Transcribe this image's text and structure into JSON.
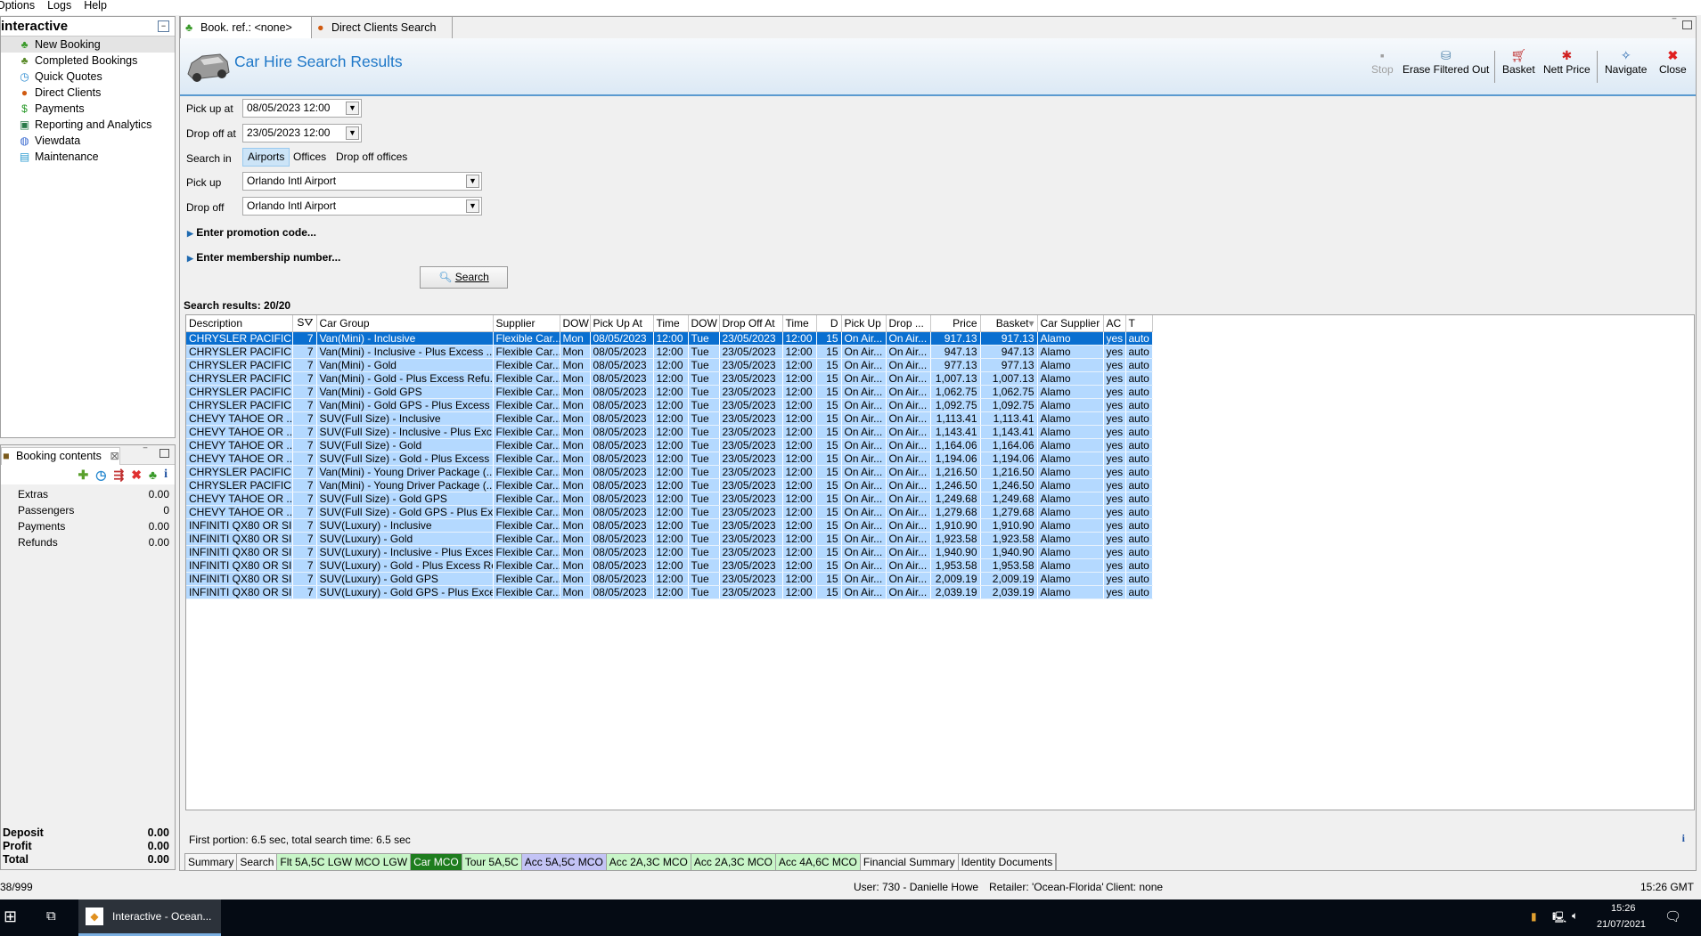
{
  "menu": [
    "Options",
    "Logs",
    "Help"
  ],
  "left": {
    "title": "interactive",
    "items": [
      {
        "label": "New Booking",
        "icon": "palm-tree-icon"
      },
      {
        "label": "Completed Bookings",
        "icon": "palm-money-icon"
      },
      {
        "label": "Quick Quotes",
        "icon": "clock-icon"
      },
      {
        "label": "Direct Clients",
        "icon": "person-icon"
      },
      {
        "label": "Payments",
        "icon": "dollar-icon"
      },
      {
        "label": "Reporting and Analytics",
        "icon": "report-icon"
      },
      {
        "label": "Viewdata",
        "icon": "globe-icon"
      },
      {
        "label": "Maintenance",
        "icon": "books-icon"
      }
    ]
  },
  "booking": {
    "title": "Booking contents",
    "rows": [
      {
        "label": "Extras",
        "value": "0.00"
      },
      {
        "label": "Passengers",
        "value": "0"
      },
      {
        "label": "Payments",
        "value": "0.00"
      },
      {
        "label": "Refunds",
        "value": "0.00"
      }
    ],
    "totals": [
      {
        "label": "Deposit",
        "value": "0.00"
      },
      {
        "label": "Profit",
        "value": "0.00"
      },
      {
        "label": "Total",
        "value": "0.00"
      }
    ]
  },
  "tabs": [
    {
      "label": "Book. ref.: <none>"
    },
    {
      "label": "Direct Clients Search"
    }
  ],
  "header": {
    "title": "Car Hire Search Results"
  },
  "toolbar": {
    "stop": "Stop",
    "erase": "Erase Filtered Out",
    "basket": "Basket",
    "nett": "Nett Price",
    "navigate": "Navigate",
    "close": "Close"
  },
  "form": {
    "pickup_at_label": "Pick up at",
    "pickup_at": "08/05/2023 12:00",
    "dropoff_at_label": "Drop off at",
    "dropoff_at": "23/05/2023 12:00",
    "search_in_label": "Search in",
    "search_in_options": [
      "Airports",
      "Offices",
      "Drop off offices"
    ],
    "search_in_selected": "Airports",
    "pickup_label": "Pick up",
    "pickup": "Orlando Intl Airport",
    "dropoff_label": "Drop off",
    "dropoff": "Orlando Intl Airport",
    "promo": "Enter promotion code...",
    "membership": "Enter membership number...",
    "search_button": "Search"
  },
  "results": {
    "label": "Search results: 20/20",
    "columns": [
      "Description",
      "S",
      "Car Group",
      "Supplier",
      "DOW",
      "Pick Up At",
      "Time",
      "DOW",
      "Drop Off At",
      "Time",
      "D",
      "Pick Up",
      "Drop ...",
      "Price",
      "Basket",
      "Car Supplier",
      "AC",
      "T"
    ],
    "rows": [
      [
        "CHRYSLER PACIFIC...",
        "7",
        "Van(Mini) - Inclusive",
        "917.13"
      ],
      [
        "CHRYSLER PACIFIC...",
        "7",
        "Van(Mini) - Inclusive - Plus Excess ...",
        "947.13"
      ],
      [
        "CHRYSLER PACIFIC...",
        "7",
        "Van(Mini) - Gold",
        "977.13"
      ],
      [
        "CHRYSLER PACIFIC...",
        "7",
        "Van(Mini) - Gold - Plus Excess Refu...",
        "1,007.13"
      ],
      [
        "CHRYSLER PACIFIC...",
        "7",
        "Van(Mini) - Gold GPS",
        "1,062.75"
      ],
      [
        "CHRYSLER PACIFIC...",
        "7",
        "Van(Mini) - Gold GPS - Plus Excess ...",
        "1,092.75"
      ],
      [
        "CHEVY TAHOE OR ...",
        "7",
        "SUV(Full Size) - Inclusive",
        "1,113.41"
      ],
      [
        "CHEVY TAHOE OR ...",
        "7",
        "SUV(Full Size) - Inclusive - Plus Exc...",
        "1,143.41"
      ],
      [
        "CHEVY TAHOE OR ...",
        "7",
        "SUV(Full Size) - Gold",
        "1,164.06"
      ],
      [
        "CHEVY TAHOE OR ...",
        "7",
        "SUV(Full Size) - Gold - Plus Excess ...",
        "1,194.06"
      ],
      [
        "CHRYSLER PACIFIC...",
        "7",
        "Van(Mini) - Young Driver Package (...",
        "1,216.50"
      ],
      [
        "CHRYSLER PACIFIC...",
        "7",
        "Van(Mini) - Young Driver Package (...",
        "1,246.50"
      ],
      [
        "CHEVY TAHOE OR ...",
        "7",
        "SUV(Full Size) - Gold GPS",
        "1,249.68"
      ],
      [
        "CHEVY TAHOE OR ...",
        "7",
        "SUV(Full Size) - Gold GPS - Plus Exc...",
        "1,279.68"
      ],
      [
        "INFINITI QX80 OR SI...",
        "7",
        "SUV(Luxury) - Inclusive",
        "1,910.90"
      ],
      [
        "INFINITI QX80 OR SI...",
        "7",
        "SUV(Luxury) - Gold",
        "1,923.58"
      ],
      [
        "INFINITI QX80 OR SI...",
        "7",
        "SUV(Luxury) - Inclusive - Plus Exces...",
        "1,940.90"
      ],
      [
        "INFINITI QX80 OR SI...",
        "7",
        "SUV(Luxury) - Gold - Plus Excess Re...",
        "1,953.58"
      ],
      [
        "INFINITI QX80 OR SI...",
        "7",
        "SUV(Luxury) - Gold GPS",
        "2,009.19"
      ],
      [
        "INFINITI QX80 OR SI...",
        "7",
        "SUV(Luxury) - Gold GPS - Plus Exce...",
        "2,039.19"
      ]
    ],
    "common": {
      "supplier": "Flexible Car...",
      "dow1": "Mon",
      "pickup_at": "08/05/2023",
      "time1": "12:00",
      "dow2": "Tue",
      "dropoff_at": "23/05/2023",
      "time2": "12:00",
      "days": "15",
      "pickup": "On Air...",
      "dropoff": "On Air...",
      "car_supplier": "Alamo",
      "ac": "yes",
      "t": "auto"
    }
  },
  "footer": {
    "timing": "First portion: 6.5 sec, total search time: 6.5 sec"
  },
  "bottom_tabs": [
    {
      "label": "Summary",
      "color": "#f5f5f5"
    },
    {
      "label": "Search",
      "color": "#f5f5f5"
    },
    {
      "label": "Flt 5A,5C LGW MCO LGW",
      "color": "#c8f5c8"
    },
    {
      "label": "Car MCO",
      "color": "#1e7d1e"
    },
    {
      "label": "Tour 5A,5C",
      "color": "#c8f5c8"
    },
    {
      "label": "Acc 5A,5C MCO",
      "color": "#c3c3f5"
    },
    {
      "label": "Acc 2A,3C MCO",
      "color": "#c8f5c8"
    },
    {
      "label": "Acc 2A,3C MCO",
      "color": "#c8f5c8"
    },
    {
      "label": "Acc 4A,6C MCO",
      "color": "#c8f5c8"
    },
    {
      "label": "Financial Summary",
      "color": "#f5f5f5"
    },
    {
      "label": "Identity Documents",
      "color": "#f5f5f5"
    }
  ],
  "status": {
    "counter": "38/999",
    "user": "User: 730 - Danielle Howe",
    "retailer": "Retailer: 'Ocean-Florida'",
    "client": "Client: none",
    "time": "15:26 GMT"
  },
  "taskbar": {
    "app": "Interactive - Ocean...",
    "time": "15:26",
    "date": "21/07/2021"
  },
  "colors": {
    "accent": "#1f78c8",
    "selection": "#0a6fd0",
    "row": "#b4d9ff"
  }
}
